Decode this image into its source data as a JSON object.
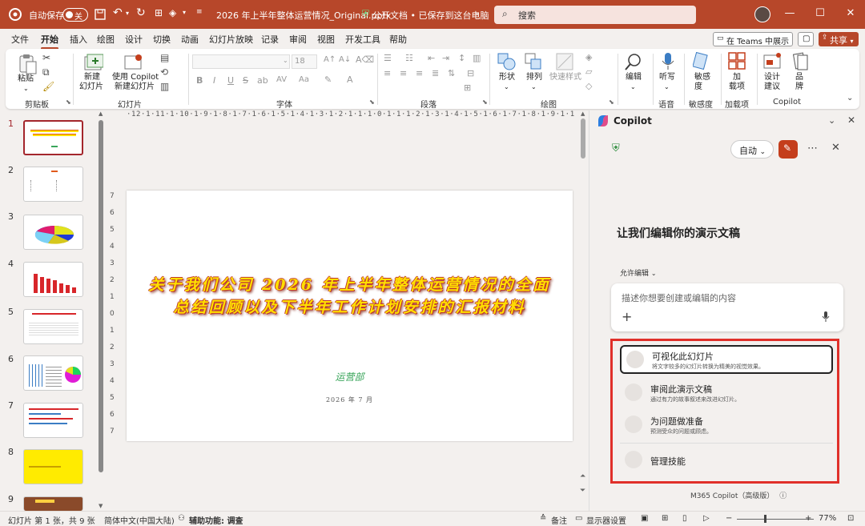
{
  "titlebar": {
    "autosave_label": "自动保存",
    "autosave_state": "关",
    "filename": "2026 年上半年整体运营情况_Original.pptx",
    "doc_status": "公开文档 • 已保存到这台电脑",
    "search_placeholder": "搜索"
  },
  "menu": {
    "tabs": [
      "文件",
      "开始",
      "插入",
      "绘图",
      "设计",
      "切换",
      "动画",
      "幻灯片放映",
      "记录",
      "审阅",
      "视图",
      "开发工具",
      "帮助"
    ],
    "active": "开始",
    "teams_label": "在 Teams 中展示",
    "share_label": "共享"
  },
  "ribbon": {
    "clipboard": {
      "paste": "粘贴",
      "group": "剪贴板"
    },
    "slides": {
      "new_slide_1": "新建",
      "new_slide_2": "幻灯片",
      "copilot_1": "使用 Copilot",
      "copilot_2": "新建幻灯片",
      "group": "幻灯片"
    },
    "font": {
      "size": "18",
      "group": "字体"
    },
    "paragraph": {
      "group": "段落"
    },
    "drawing": {
      "shape": "形状",
      "arrange": "排列",
      "quick_style": "快速样式",
      "group": "绘图"
    },
    "editing": {
      "edit": "编辑"
    },
    "voice": {
      "dictate": "听写",
      "group": "语音"
    },
    "sensitivity": {
      "label_1": "敏感",
      "label_2": "度",
      "group": "敏感度"
    },
    "addins": {
      "label_1": "加",
      "label_2": "载项",
      "group": "加载项"
    },
    "copilot_group": {
      "design_1": "设计",
      "design_2": "建议",
      "brand_1": "品",
      "brand_2": "牌",
      "group": "Copilot"
    }
  },
  "slides_panel": {
    "numbers": [
      "1",
      "2",
      "3",
      "4",
      "5",
      "6",
      "7",
      "8",
      "9"
    ],
    "selected": 1
  },
  "ruler": {
    "top": "·12·1·11·1·10·1·9·1·8·1·7·1·6·1·5·1·4·1·3·1·2·1·1·1·0·1·1·1·2·1·3·1·4·1·5·1·6·1·7·1·8·1·9·1·10·1·11·1·12",
    "left": [
      "7",
      "6",
      "5",
      "4",
      "3",
      "2",
      "1",
      "0",
      "1",
      "2",
      "3",
      "4",
      "5",
      "6",
      "7"
    ]
  },
  "slide": {
    "title_line1": "关于我们公司 2026 年上半年整体运营情况的全面",
    "title_line2": "总结回顾以及下半年工作计划安排的汇报材料",
    "department": "运营部",
    "date": "2026 年 7 月"
  },
  "copilot": {
    "title": "Copilot",
    "mode": "自动",
    "heading": "让我们编辑你的演示文稿",
    "allow_edit": "允许编辑",
    "input_placeholder": "描述你想要创建或编辑的内容",
    "suggestions": [
      {
        "title": "可视化此幻灯片",
        "desc": "将文字较多的幻灯片转换为精美的视觉效果。"
      },
      {
        "title": "审阅此演示文稿",
        "desc": "通过有力的故事叙述来改进幻灯片。"
      },
      {
        "title": "为问题做准备",
        "desc": "预测受众的问题或顾虑。"
      },
      {
        "title": "管理技能",
        "desc": ""
      }
    ],
    "footer": "M365 Copilot（高级版）"
  },
  "statusbar": {
    "slide_info": "幻灯片 第 1 张，共 9 张",
    "language": "简体中文(中国大陆)",
    "accessibility": "辅助功能: 调查",
    "notes": "备注",
    "display_settings": "显示器设置",
    "zoom": "77%"
  },
  "colors": {
    "accent": "#b7472a",
    "highlight_box": "#e0302a",
    "slide_title": "#ffe000",
    "dept": "#3aa55b"
  }
}
